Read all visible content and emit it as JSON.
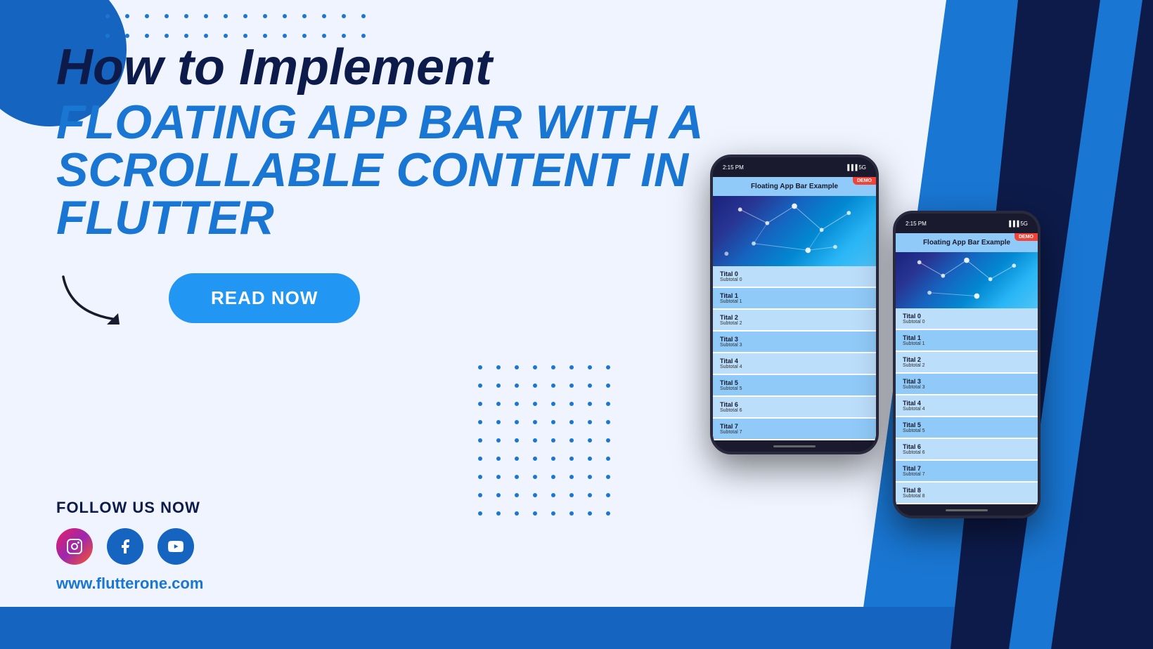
{
  "background": {
    "accent_color": "#1976d2",
    "dark_color": "#0d1b4b"
  },
  "headline": {
    "line1": "How to Implement",
    "line2": "FLOATING APP BAR WITH A",
    "line3": "SCROLLABLE CONTENT IN FLUTTER"
  },
  "cta": {
    "button_label": "READ NOW"
  },
  "social": {
    "follow_label": "FOLLOW US NOW",
    "website": "www.flutterone.com",
    "icons": [
      "instagram",
      "facebook",
      "youtube"
    ]
  },
  "phone1": {
    "time": "2:15 PM",
    "signal": "5G",
    "app_bar_title": "Floating App Bar Example",
    "demo_badge": "DEMO",
    "list_items": [
      {
        "title": "Tital 0",
        "subtitle": "Subtotal 0"
      },
      {
        "title": "Tital 1",
        "subtitle": "Subtotal 1"
      },
      {
        "title": "Tital 2",
        "subtitle": "Subtotal 2"
      },
      {
        "title": "Tital 3",
        "subtitle": "Subtotal 3"
      },
      {
        "title": "Tital 4",
        "subtitle": "Subtotal 4"
      },
      {
        "title": "Tital 5",
        "subtitle": "Subtotal 5"
      },
      {
        "title": "Tital 6",
        "subtitle": "Subtotal 6"
      },
      {
        "title": "Tital 7",
        "subtitle": "Subtotal 7"
      }
    ]
  },
  "phone2": {
    "time": "2:15 PM",
    "signal": "5G",
    "app_bar_title": "Floating App Bar Example",
    "demo_badge": "DEMO",
    "list_items": [
      {
        "title": "Tital 0",
        "subtitle": "Subtotal 0"
      },
      {
        "title": "Tital 1",
        "subtitle": "Subtotal 1"
      },
      {
        "title": "Tital 2",
        "subtitle": "Subtotal 2"
      },
      {
        "title": "Tital 3",
        "subtitle": "Subtotal 3"
      },
      {
        "title": "Tital 4",
        "subtitle": "Subtotal 4"
      },
      {
        "title": "Tital 5",
        "subtitle": "Subtotal 5"
      },
      {
        "title": "Tital 6",
        "subtitle": "Subtotal 6"
      },
      {
        "title": "Tital 7",
        "subtitle": "Subtotal 7"
      },
      {
        "title": "Tital 8",
        "subtitle": "Subtotal 8"
      }
    ]
  }
}
